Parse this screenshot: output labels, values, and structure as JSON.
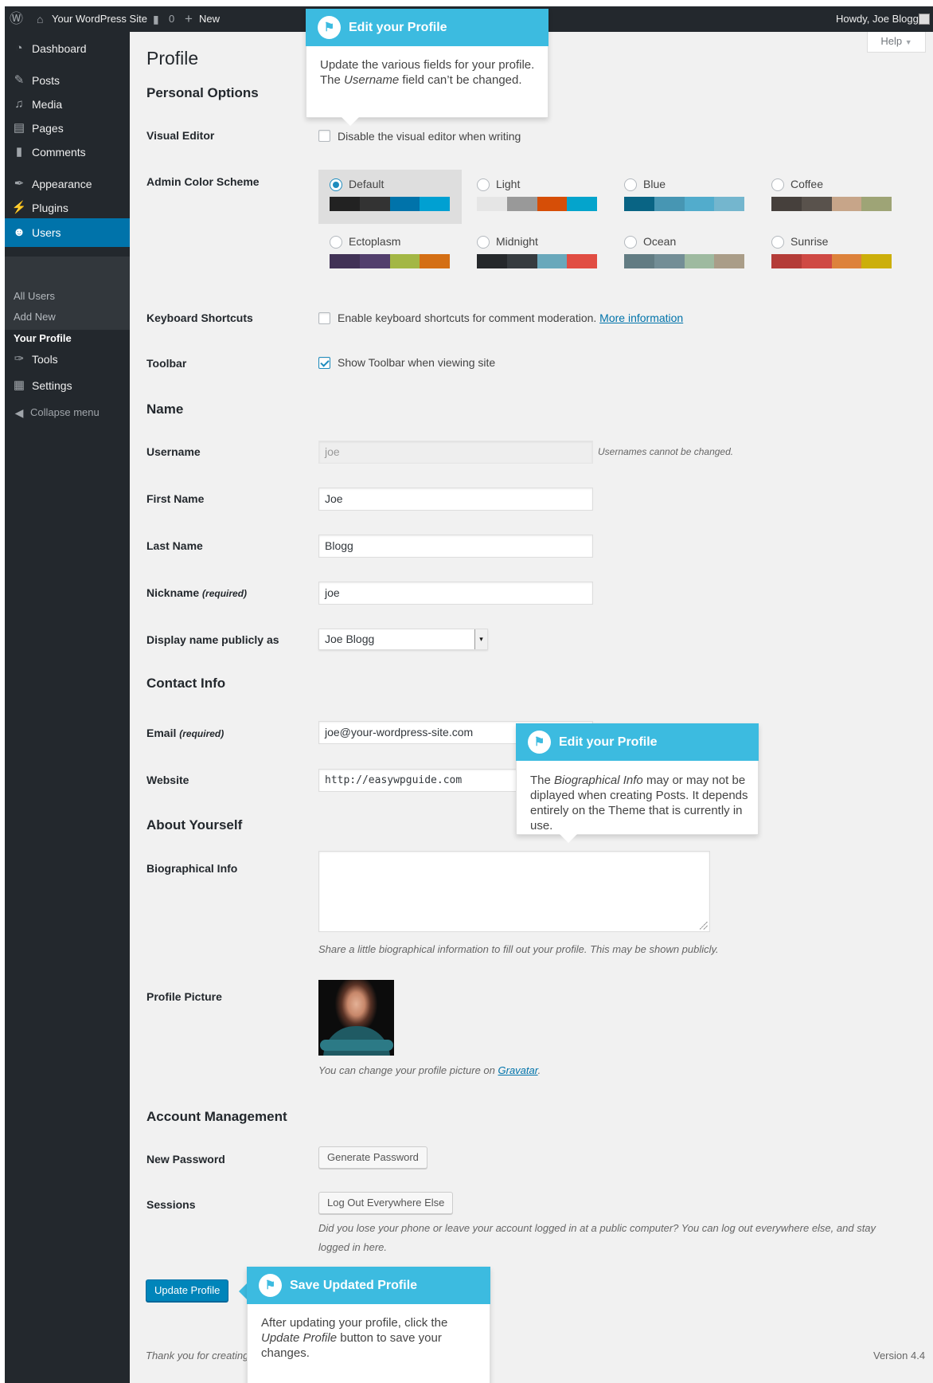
{
  "adminbar": {
    "site_name": "Your WordPress Site",
    "comments_count": "0",
    "new_label": "New",
    "howdy": "Howdy, Joe Blogg"
  },
  "sidebar": {
    "items": [
      {
        "label": "Dashboard",
        "icon": "dashboard-icon"
      },
      {
        "label": "Posts",
        "icon": "pin-icon"
      },
      {
        "label": "Media",
        "icon": "media-icon"
      },
      {
        "label": "Pages",
        "icon": "pages-icon"
      },
      {
        "label": "Comments",
        "icon": "comment-icon"
      },
      {
        "label": "Appearance",
        "icon": "brush-icon"
      },
      {
        "label": "Plugins",
        "icon": "plugin-icon"
      },
      {
        "label": "Users",
        "icon": "user-icon"
      },
      {
        "label": "Tools",
        "icon": "wrench-icon"
      },
      {
        "label": "Settings",
        "icon": "settings-icon"
      }
    ],
    "submenu": [
      "All Users",
      "Add New",
      "Your Profile"
    ],
    "collapse_label": "Collapse menu"
  },
  "help_label": "Help",
  "page_title": "Profile",
  "sections": {
    "personal_options": "Personal Options",
    "name": "Name",
    "contact_info": "Contact Info",
    "about_yourself": "About Yourself",
    "account_management": "Account Management"
  },
  "labels": {
    "visual_editor": "Visual Editor",
    "admin_color_scheme": "Admin Color Scheme",
    "keyboard_shortcuts": "Keyboard Shortcuts",
    "toolbar": "Toolbar",
    "username": "Username",
    "first_name": "First Name",
    "last_name": "Last Name",
    "nickname": "Nickname",
    "required": "(required)",
    "display_name": "Display name publicly as",
    "email": "Email",
    "website": "Website",
    "bio": "Biographical Info",
    "profile_picture": "Profile Picture",
    "new_password": "New Password",
    "sessions": "Sessions"
  },
  "checkboxes": {
    "visual_editor": {
      "text": "Disable the visual editor when writing",
      "checked": false
    },
    "keyboard_shortcuts": {
      "text": "Enable keyboard shortcuts for comment moderation.",
      "link": "More information",
      "checked": false
    },
    "toolbar": {
      "text": "Show Toolbar when viewing site",
      "checked": true
    }
  },
  "color_schemes": [
    {
      "name": "Default",
      "selected": true,
      "colors": [
        "#222222",
        "#333333",
        "#0073aa",
        "#00a0d2"
      ]
    },
    {
      "name": "Light",
      "selected": false,
      "colors": [
        "#e5e5e5",
        "#999999",
        "#d64e07",
        "#04a4cc"
      ]
    },
    {
      "name": "Blue",
      "selected": false,
      "colors": [
        "#096484",
        "#4796b3",
        "#52accc",
        "#74b6ce"
      ]
    },
    {
      "name": "Coffee",
      "selected": false,
      "colors": [
        "#46403c",
        "#59524c",
        "#c7a589",
        "#9ea476"
      ]
    },
    {
      "name": "Ectoplasm",
      "selected": false,
      "colors": [
        "#413256",
        "#523f6d",
        "#a3b745",
        "#d46f15"
      ]
    },
    {
      "name": "Midnight",
      "selected": false,
      "colors": [
        "#25282b",
        "#363b3f",
        "#69a8bb",
        "#e14d43"
      ]
    },
    {
      "name": "Ocean",
      "selected": false,
      "colors": [
        "#627c83",
        "#738e96",
        "#9ebaa0",
        "#aa9d88"
      ]
    },
    {
      "name": "Sunrise",
      "selected": false,
      "colors": [
        "#b43c38",
        "#cf4944",
        "#dd823b",
        "#ccaf0b"
      ]
    }
  ],
  "fields": {
    "username": "joe",
    "username_note": "Usernames cannot be changed.",
    "first_name": "Joe",
    "last_name": "Blogg",
    "nickname": "joe",
    "display_name": "Joe Blogg",
    "email": "joe@your-wordpress-site.com",
    "website": "http://easywpguide.com",
    "bio": ""
  },
  "bio_desc": "Share a little biographical information to fill out your profile. This may be shown publicly.",
  "avatar_desc": "You can change your profile picture on",
  "avatar_link": "Gravatar",
  "buttons": {
    "generate_password": "Generate Password",
    "logout_everywhere": "Log Out Everywhere Else",
    "update_profile": "Update Profile"
  },
  "sessions_desc_1": "Did you lose your phone or leave your account logged in at a public computer? You can log out everywhere else, and stay",
  "sessions_desc_2": "logged in here.",
  "footer": {
    "thanks": "Thank you for creating",
    "version": "Version 4.4"
  },
  "pointers": [
    {
      "title": "Edit your Profile",
      "body_1": "Update the various fields for your profile. The",
      "body_em": "Username",
      "body_2": "field can’t be changed."
    },
    {
      "title": "Edit your Profile",
      "body_1": "The",
      "body_em": "Biographical Info",
      "body_2": "may or may not be diplayed when creating Posts. It depends entirely on the Theme that is currently in use."
    },
    {
      "title": "Save Updated Profile",
      "body_1": "After updating your profile, click the",
      "body_em": "Update Profile",
      "body_2": "button to save your changes."
    }
  ]
}
